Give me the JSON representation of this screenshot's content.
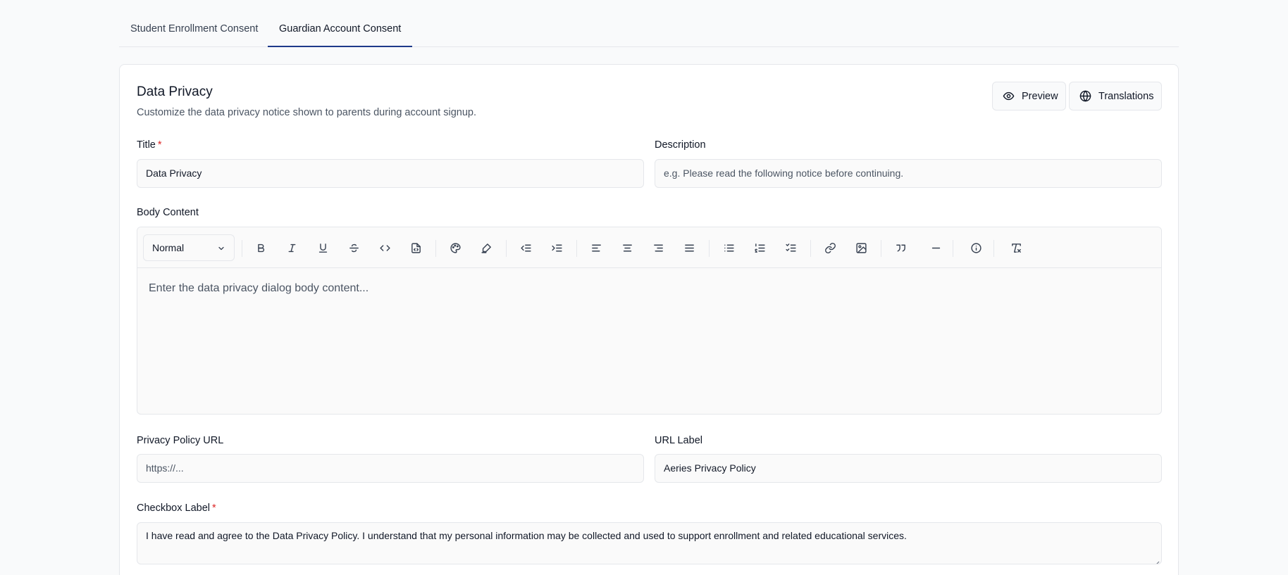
{
  "tabs": [
    {
      "label": "Student Enrollment Consent",
      "active": false
    },
    {
      "label": "Guardian Account Consent",
      "active": true
    }
  ],
  "section": {
    "title": "Data Privacy",
    "subtitle": "Customize the data privacy notice shown to parents during account signup.",
    "preview_label": "Preview",
    "translations_label": "Translations"
  },
  "form": {
    "title_label": "Title",
    "required_mark": "*",
    "title_value": "Data Privacy",
    "description_label": "Description",
    "description_placeholder": "e.g. Please read the following notice before continuing.",
    "body_label": "Body Content",
    "body_placeholder": "Enter the data privacy dialog body content...",
    "privacy_url_label": "Privacy Policy URL",
    "privacy_url_placeholder": "https://...",
    "url_label_label": "URL Label",
    "url_label_value": "Aeries Privacy Policy",
    "checkbox_label_label": "Checkbox Label",
    "checkbox_label_value": "I have read and agree to the Data Privacy Policy. I understand that my personal information may be collected and used to support enrollment and related educational services."
  },
  "editor": {
    "block_style": "Normal",
    "toolbar_icons": [
      "bold-icon",
      "italic-icon",
      "underline-icon",
      "strikethrough-icon",
      "code-icon",
      "code-block-icon",
      "text-color-icon",
      "highlight-icon",
      "outdent-icon",
      "indent-icon",
      "align-left-icon",
      "align-center-icon",
      "align-right-icon",
      "align-justify-icon",
      "bullet-list-icon",
      "numbered-list-icon",
      "checklist-icon",
      "link-icon",
      "image-icon",
      "quote-icon",
      "horizontal-rule-icon",
      "info-callout-icon",
      "clear-formatting-icon"
    ]
  },
  "colors": {
    "accent": "#1e3a8a",
    "required": "#dc2626",
    "border": "#e5e7eb"
  }
}
